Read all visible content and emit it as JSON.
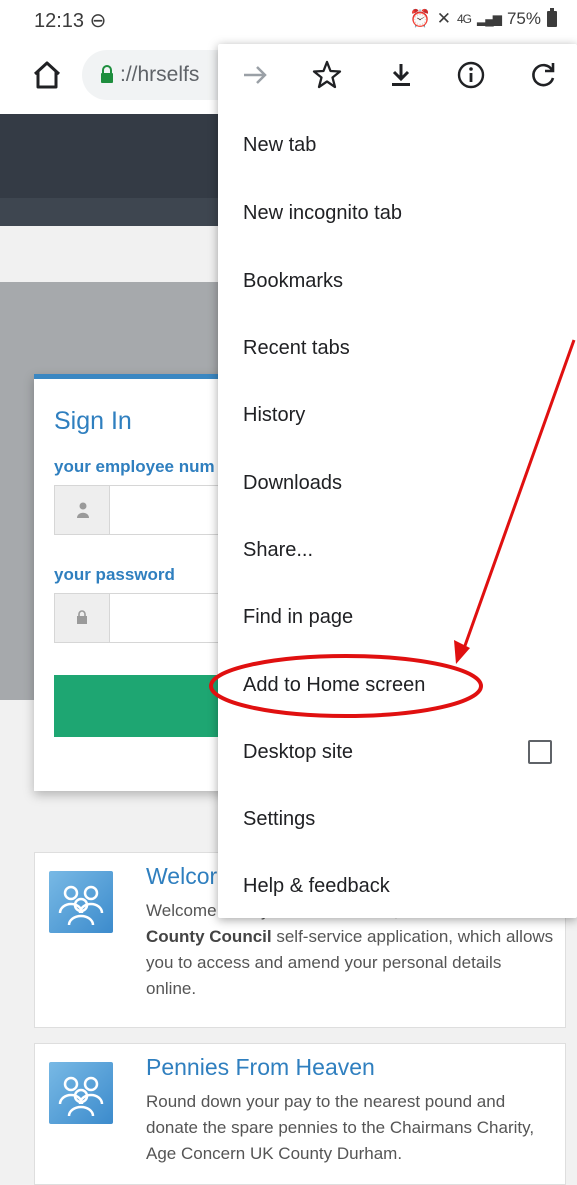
{
  "status_bar": {
    "time": "12:13",
    "battery": "75%",
    "network": "4G"
  },
  "toolbar": {
    "url": "://hrselfs"
  },
  "signin": {
    "title": "Sign In",
    "employee_label": "your employee num",
    "password_label": "your password"
  },
  "cards": [
    {
      "title": "Welcor",
      "text_before": "Welcome to PayView Dashboard, the",
      "text_bold": "Durham County Council",
      "text_after": "self-service application, which allows you to access and amend your personal details online."
    },
    {
      "title": "Pennies From Heaven",
      "text": "Round down your pay to the nearest pound and donate the spare pennies to the Chairmans Charity, Age Concern UK County Durham."
    }
  ],
  "menu": {
    "items": [
      {
        "label": "New tab"
      },
      {
        "label": "New incognito tab"
      },
      {
        "label": "Bookmarks"
      },
      {
        "label": "Recent tabs"
      },
      {
        "label": "History"
      },
      {
        "label": "Downloads"
      },
      {
        "label": "Share..."
      },
      {
        "label": "Find in page"
      },
      {
        "label": "Add to Home screen"
      },
      {
        "label": "Desktop site"
      },
      {
        "label": "Settings"
      },
      {
        "label": "Help & feedback"
      }
    ],
    "desktop_site_checked": false
  },
  "colors": {
    "accent_blue": "#2f7fbf",
    "button_green": "#1ea672",
    "annotation_red": "#e01010"
  }
}
